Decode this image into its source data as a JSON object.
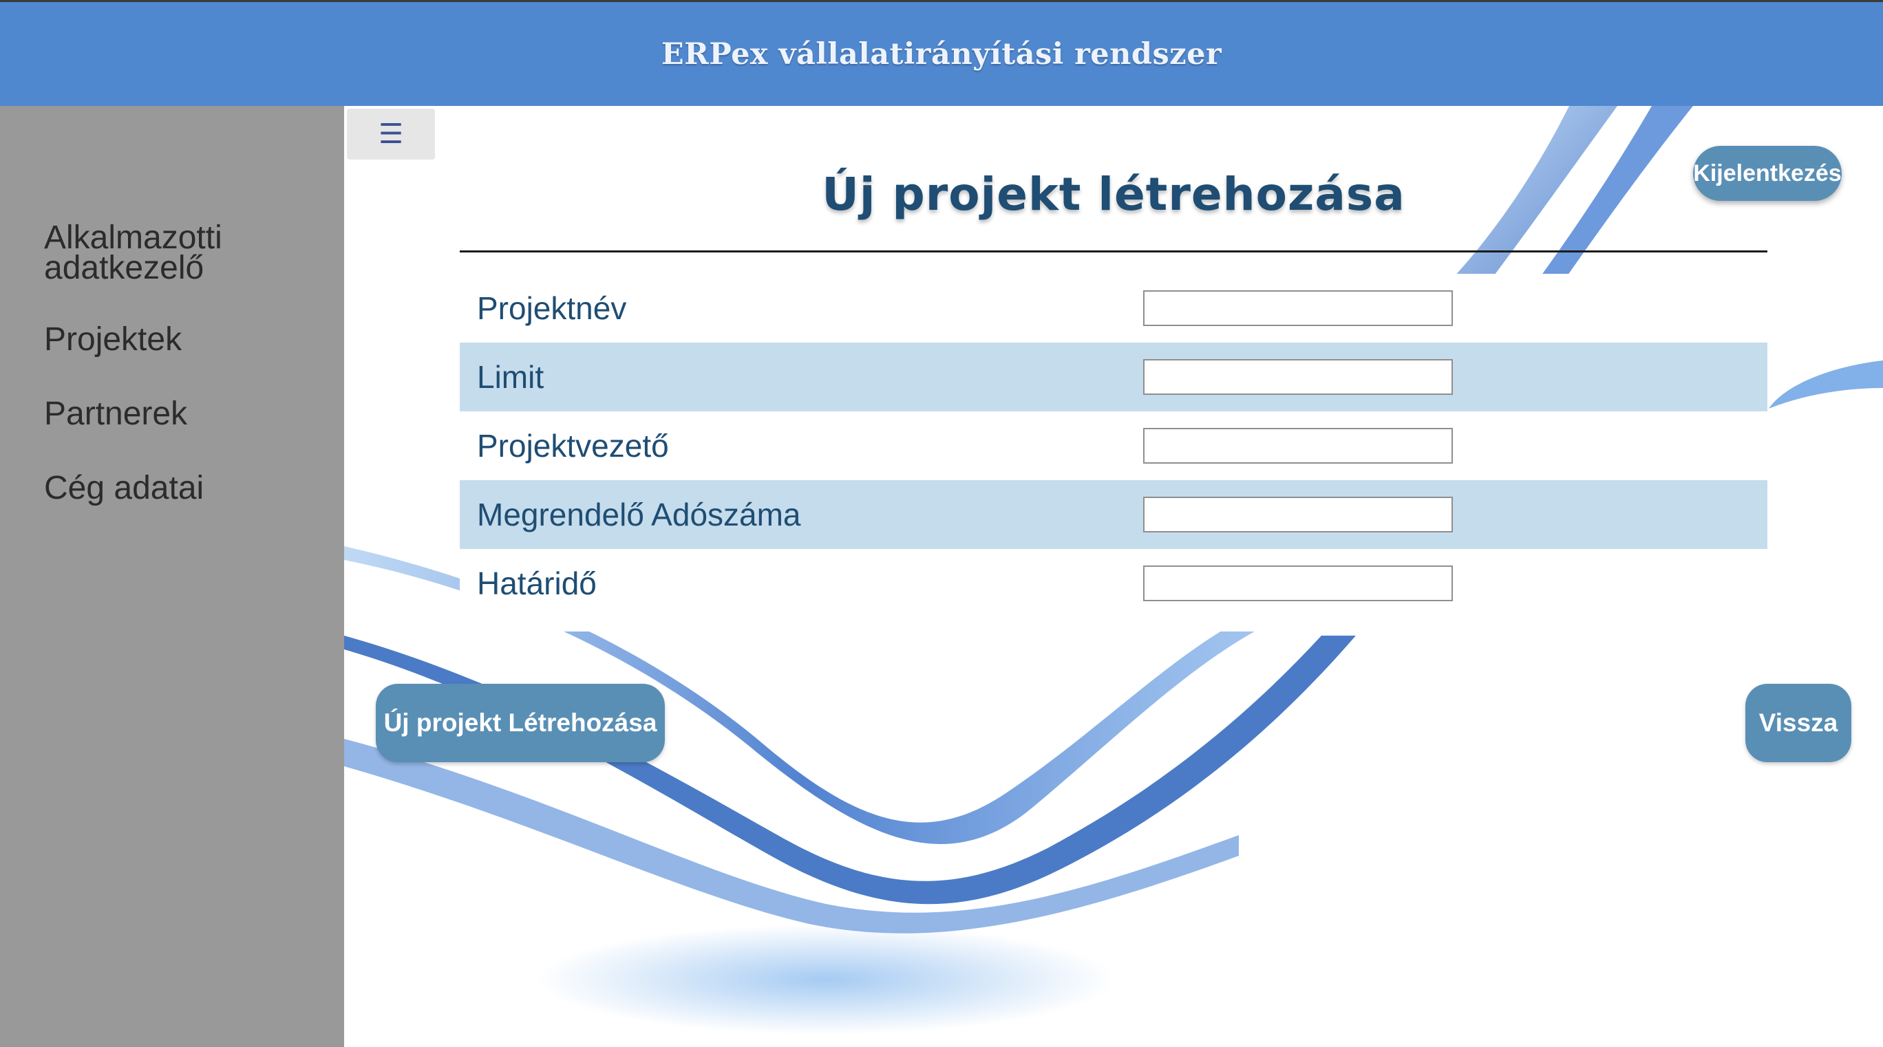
{
  "app": {
    "title": "ERPex vállalatirányítási rendszer"
  },
  "sidebar": {
    "items": [
      {
        "label": "Alkalmazotti adatkezelő"
      },
      {
        "label": "Projektek"
      },
      {
        "label": "Partnerek"
      },
      {
        "label": "Cég adatai"
      }
    ]
  },
  "toolbar": {
    "menu_icon": "☰",
    "logout_label": "Kijelentkezés"
  },
  "page": {
    "title": "Új projekt létrehozása"
  },
  "form": {
    "fields": [
      {
        "label": "Projektnév",
        "value": ""
      },
      {
        "label": "Limit",
        "value": ""
      },
      {
        "label": "Projektvezető",
        "value": ""
      },
      {
        "label": "Megrendelő Adószáma",
        "value": ""
      },
      {
        "label": "Határidő",
        "value": ""
      }
    ]
  },
  "actions": {
    "create_label": "Új projekt Létrehozása",
    "back_label": "Vissza"
  },
  "colors": {
    "header": "#5088cf",
    "sidebar": "#999999",
    "button": "#5a8fb5",
    "row_alt": "#c5dcec",
    "text_dark_blue": "#1f4d73"
  }
}
